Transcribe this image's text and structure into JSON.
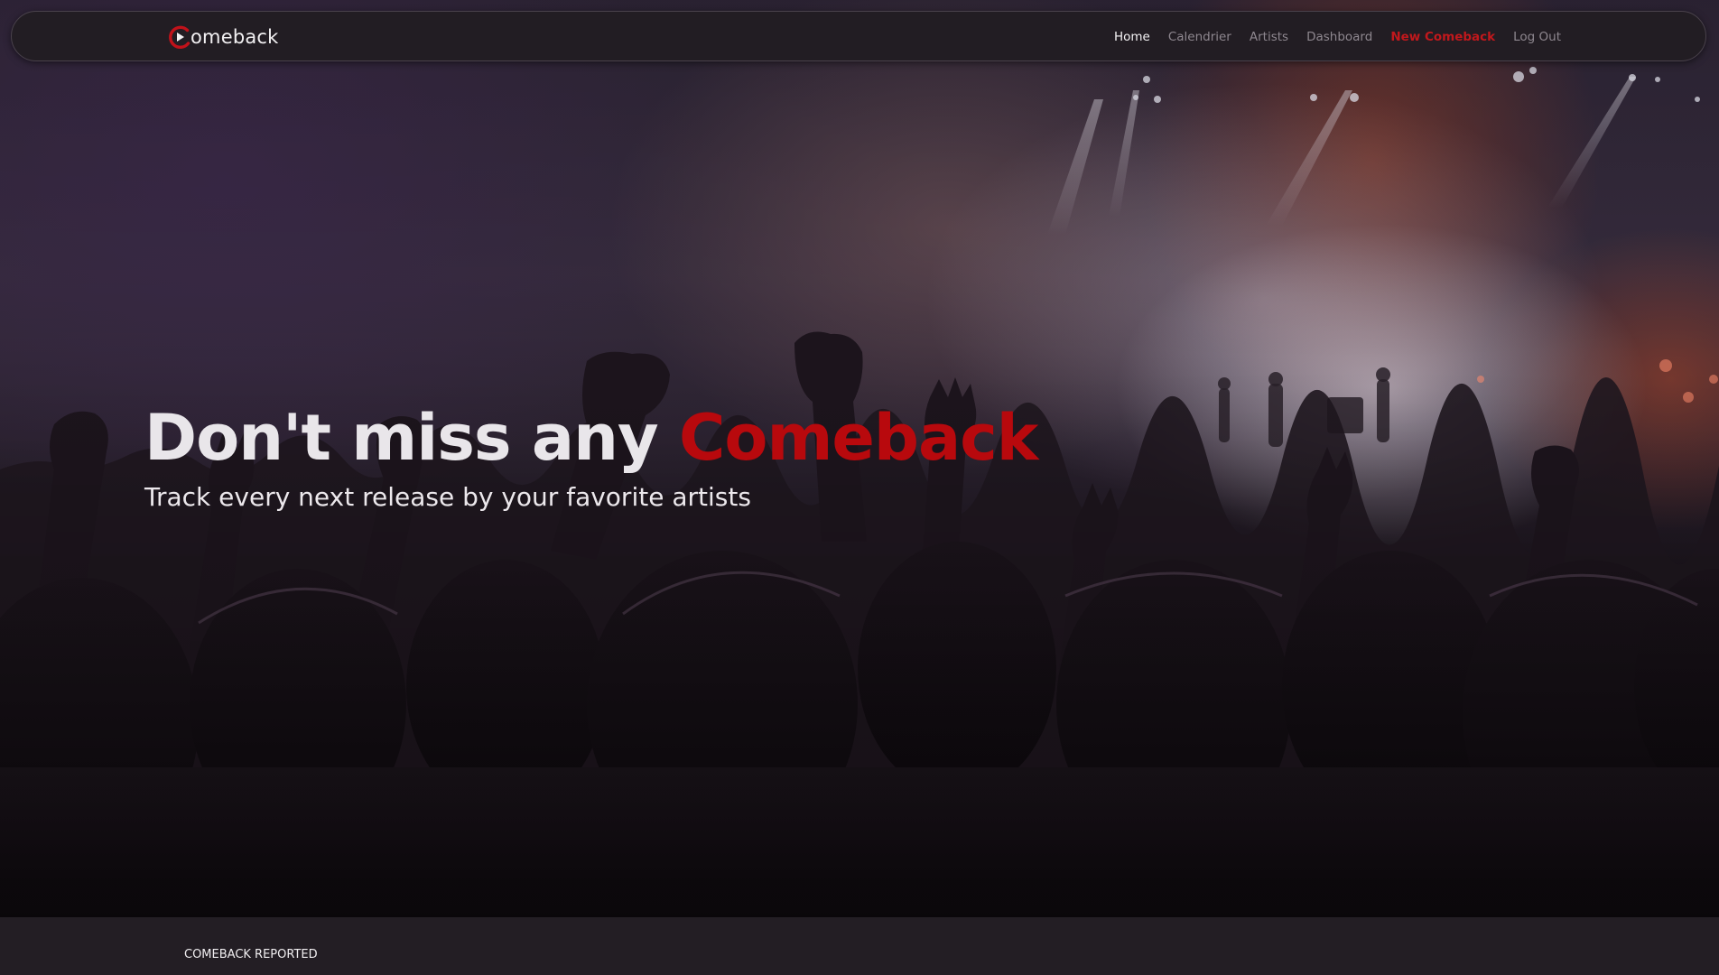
{
  "brand": {
    "logo_text": "omeback",
    "accent_color": "#b8090d"
  },
  "nav": {
    "items": [
      {
        "label": "Home",
        "state": "active"
      },
      {
        "label": "Calendrier",
        "state": "normal"
      },
      {
        "label": "Artists",
        "state": "normal"
      },
      {
        "label": "Dashboard",
        "state": "normal"
      },
      {
        "label": "New Comeback",
        "state": "highlight"
      },
      {
        "label": "Log Out",
        "state": "normal"
      }
    ]
  },
  "hero": {
    "title_prefix": "Don't miss any ",
    "title_accent": "Comeback",
    "subtitle": "Track every next release by your favorite artists",
    "background_image": "concert-crowd-photo"
  },
  "sections": {
    "comeback_reported_label": "COMEBACK REPORTED"
  },
  "colors": {
    "navbar_bg": "#221d23",
    "page_bg": "#1d191e",
    "nav_text": "#8e878f",
    "nav_active": "#f4f2f4",
    "nav_highlight": "#c1181c"
  }
}
